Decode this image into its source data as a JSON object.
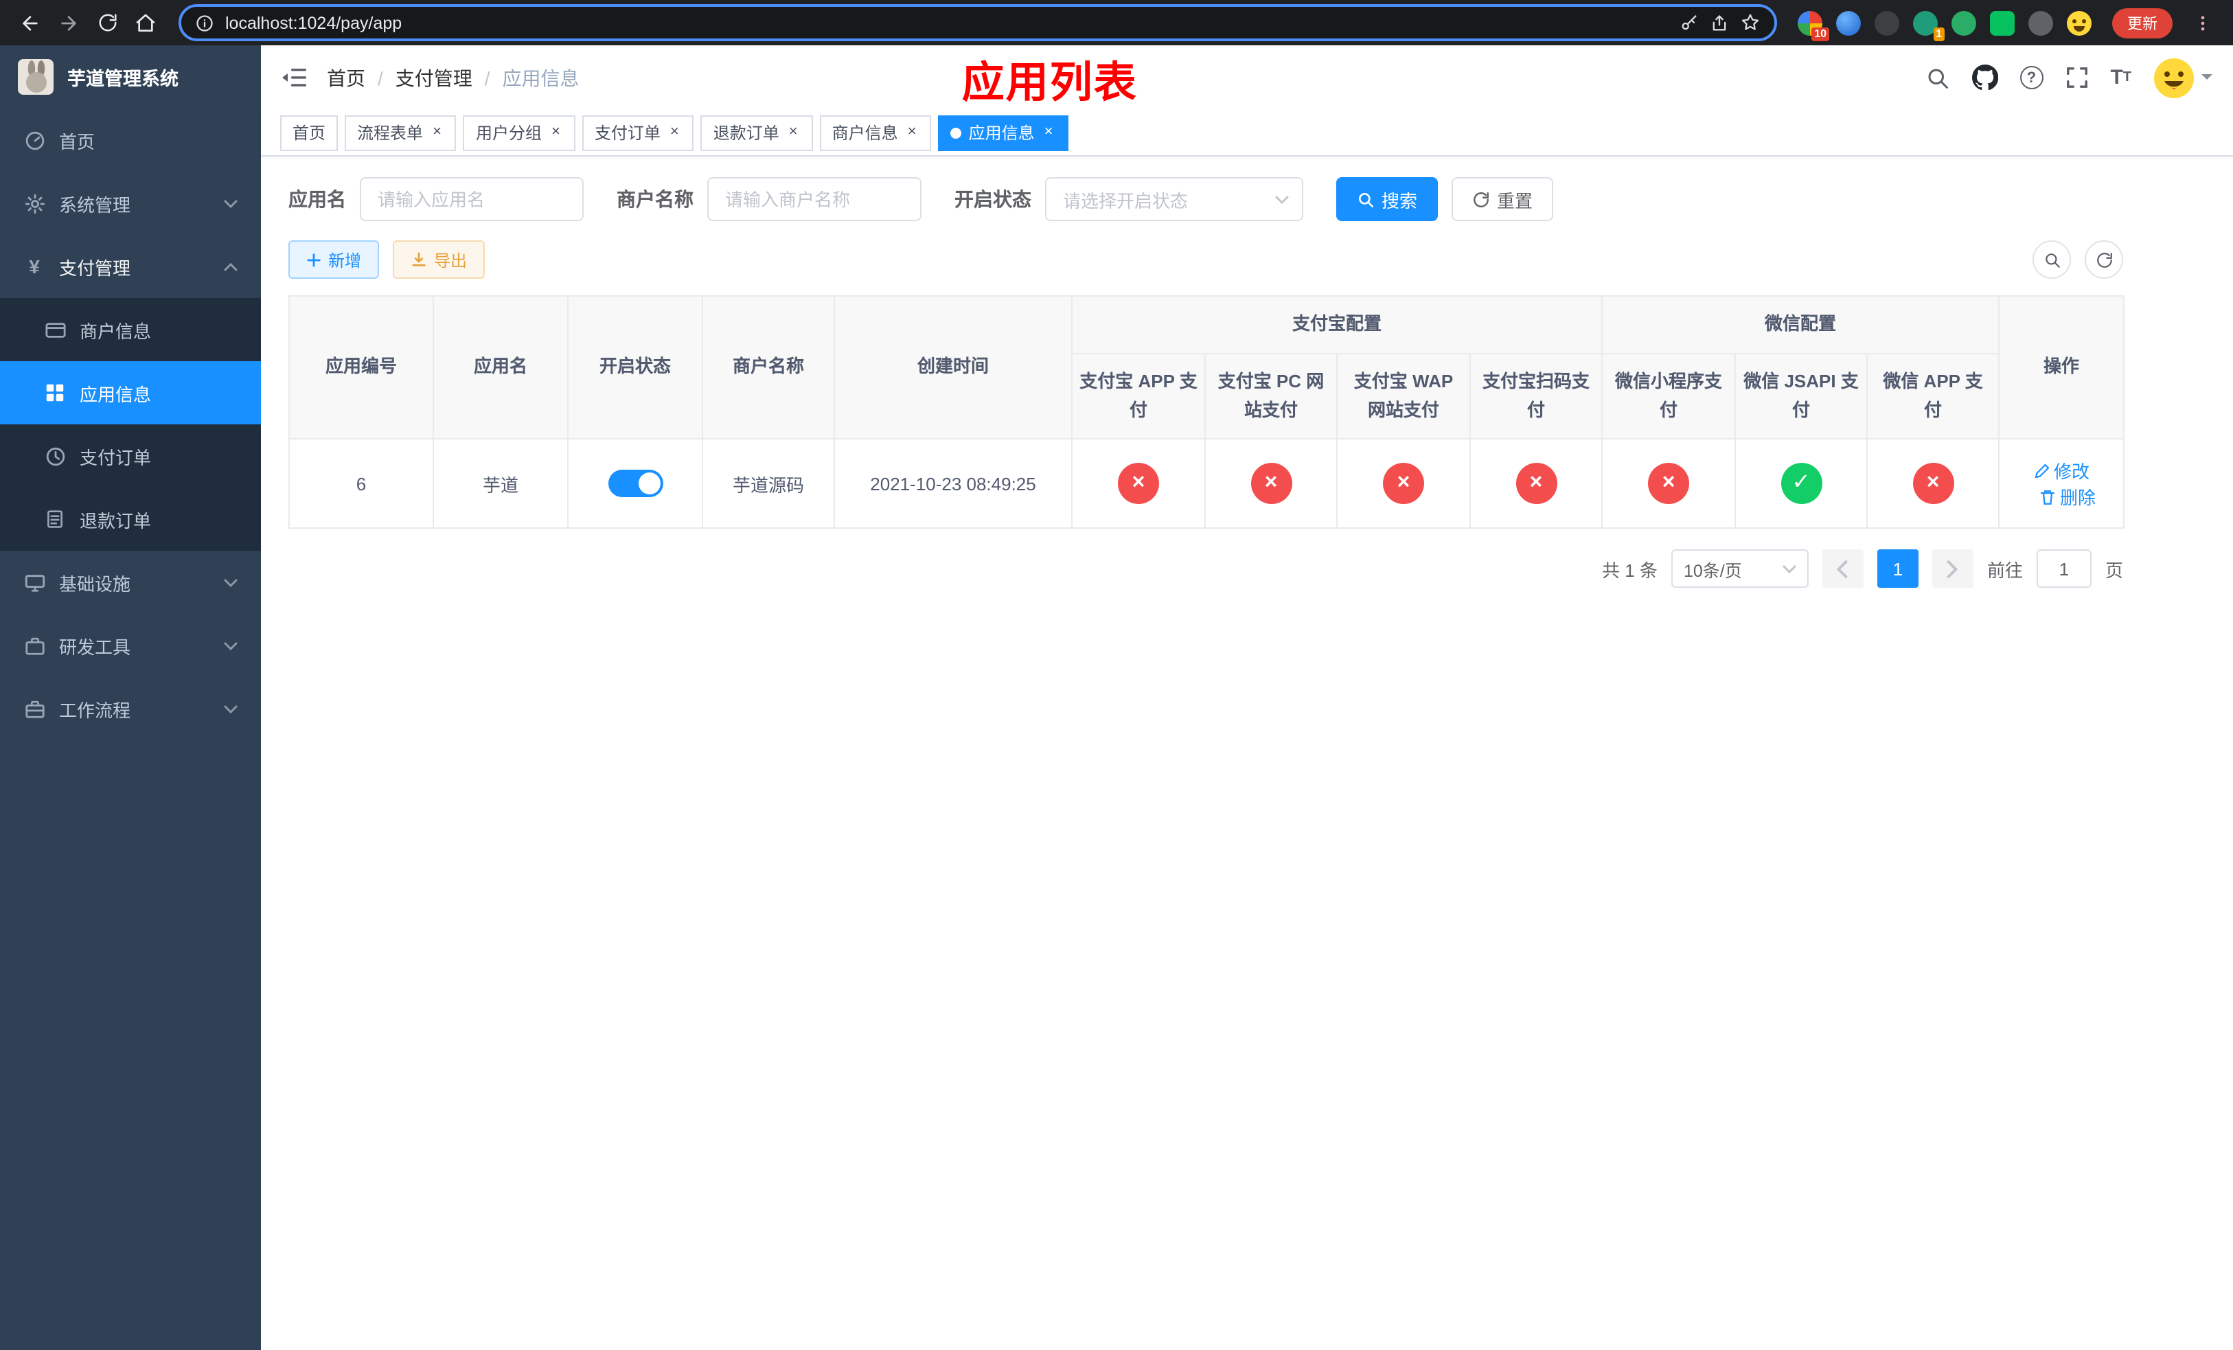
{
  "colors": {
    "accent": "#1890ff",
    "success": "#13ce66",
    "danger": "#f34d4d",
    "annotation": "#ff0000"
  },
  "browser": {
    "url": "localhost:1024/pay/app",
    "update_label": "更新",
    "ext_badge_a": "10",
    "ext_badge_b": "1"
  },
  "sidebar": {
    "title": "芋道管理系统",
    "items": [
      {
        "label": "首页"
      },
      {
        "label": "系统管理"
      },
      {
        "label": "支付管理",
        "children": [
          {
            "label": "商户信息"
          },
          {
            "label": "应用信息"
          },
          {
            "label": "支付订单"
          },
          {
            "label": "退款订单"
          }
        ]
      },
      {
        "label": "基础设施"
      },
      {
        "label": "研发工具"
      },
      {
        "label": "工作流程"
      }
    ]
  },
  "header": {
    "breadcrumb": [
      "首页",
      "支付管理",
      "应用信息"
    ],
    "separator": "/",
    "overlay_title": "应用列表"
  },
  "tabs": [
    {
      "label": "首页"
    },
    {
      "label": "流程表单"
    },
    {
      "label": "用户分组"
    },
    {
      "label": "支付订单"
    },
    {
      "label": "退款订单"
    },
    {
      "label": "商户信息"
    },
    {
      "label": "应用信息"
    }
  ],
  "filters": {
    "app_name_label": "应用名",
    "app_name_placeholder": "请输入应用名",
    "merchant_label": "商户名称",
    "merchant_placeholder": "请输入商户名称",
    "status_label": "开启状态",
    "status_placeholder": "请选择开启状态",
    "search_label": "搜索",
    "reset_label": "重置"
  },
  "toolbar": {
    "add_label": "新增",
    "export_label": "导出"
  },
  "table": {
    "simple_columns": [
      "应用编号",
      "应用名",
      "开启状态",
      "商户名称",
      "创建时间"
    ],
    "alipay_group": "支付宝配置",
    "wechat_group": "微信配置",
    "alipay_columns": [
      "支付宝 APP 支付",
      "支付宝 PC 网站支付",
      "支付宝 WAP 网站支付",
      "支付宝扫码支付"
    ],
    "wechat_columns": [
      "微信小程序支付",
      "微信 JSAPI 支付",
      "微信 APP 支付"
    ],
    "op_column": "操作",
    "rows": [
      {
        "id": "6",
        "name": "芋道",
        "enabled": true,
        "merchant": "芋道源码",
        "created": "2021-10-23 08:49:25",
        "statuses": [
          false,
          false,
          false,
          false,
          false,
          true,
          false
        ],
        "edit_label": "修改",
        "delete_label": "删除"
      }
    ]
  },
  "pagination": {
    "total": "共 1 条",
    "page_size": "10条/页",
    "page": "1",
    "goto_label": "前往",
    "goto_value": "1",
    "page_unit": "页"
  }
}
